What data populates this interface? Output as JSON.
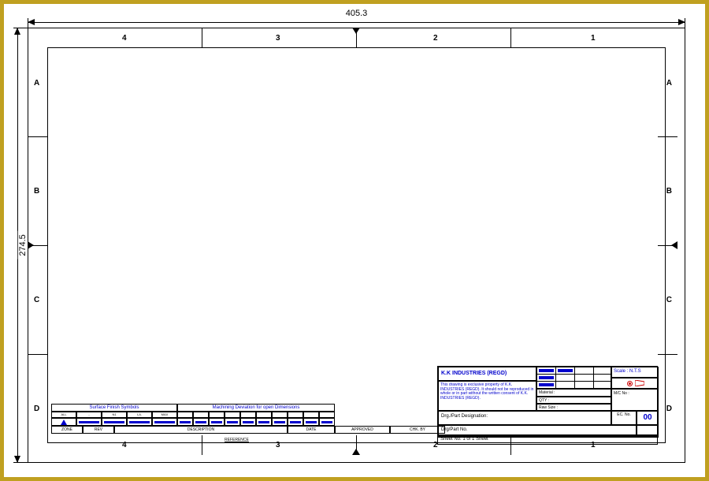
{
  "dimensions": {
    "width_label": "405.3",
    "height_label": "274.5"
  },
  "zones": {
    "columns": [
      "4",
      "3",
      "2",
      "1"
    ],
    "rows": [
      "A",
      "B",
      "C",
      "D"
    ]
  },
  "title_block": {
    "company": "K.K INDUSTRIES (REGD)",
    "note": "This drawing is exclusive property of K.K. INDUSTRIES (REGD). It should not be reproduced in whole or in part without the written consent of K.K. INDUSTRIES (REGD).",
    "scale_label": "Scale : N.T.S",
    "material_label": "Material :",
    "qty_label": "QTY :",
    "rawsize_label": "Raw Size :",
    "mc_label": "M/C No :",
    "designation_label": "Drg./Part Designation:",
    "drg_label": "Drg/Part No.",
    "ec_label": "EC. No.",
    "ec_no": "00",
    "sheet_label": "Sheet No.  1 of 1 Sheet"
  },
  "rev_table": {
    "surface_header": "Surface Finish Symbols",
    "machining_header": "Machining Deviation for open Dimensions",
    "sf_cols": [
      "ALL",
      "-",
      "N1",
      "L/L",
      "MAX"
    ],
    "mc_cols": [
      "-",
      "-",
      "-",
      "-",
      "-",
      "-",
      "-",
      "-",
      "-",
      "-"
    ],
    "bottom_cols": [
      "ZONE",
      "REV",
      "DESCRIPTION",
      "DATE",
      "APPROVED",
      "CHK. BY"
    ],
    "reference_label": "REFERENCE"
  }
}
